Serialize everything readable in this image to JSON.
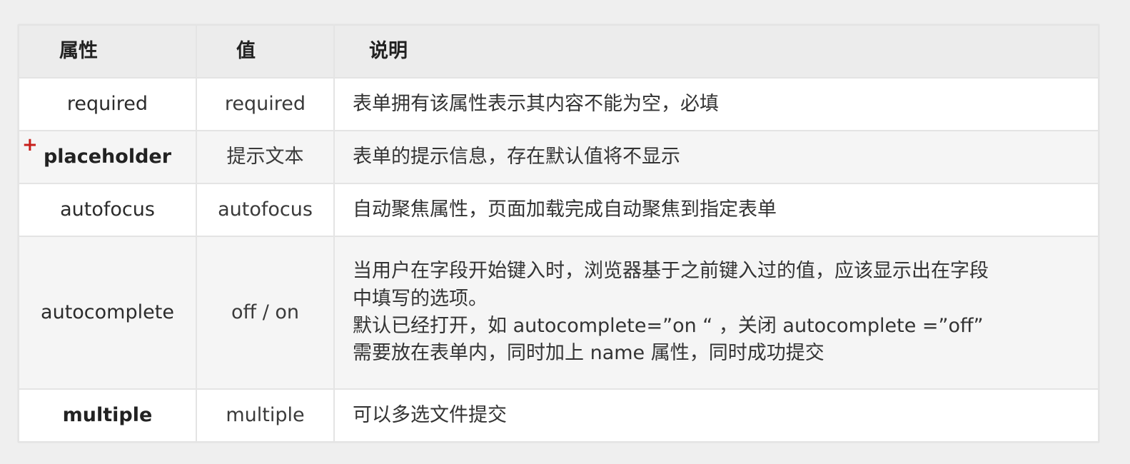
{
  "table": {
    "headers": [
      "属性",
      "值",
      "说明"
    ],
    "rows": [
      {
        "attribute": "required",
        "value": "required",
        "description": [
          "表单拥有该属性表示其内容不能为空，必填"
        ]
      },
      {
        "attribute": "placeholder",
        "value": "提示文本",
        "description": [
          "表单的提示信息，存在默认值将不显示"
        ],
        "marker": "+"
      },
      {
        "attribute": "autofocus",
        "value": "autofocus",
        "description": [
          "自动聚焦属性，页面加载完成自动聚焦到指定表单"
        ]
      },
      {
        "attribute": "autocomplete",
        "value": "off / on",
        "description": [
          "当用户在字段开始键入时，浏览器基于之前键入过的值，应该显示出在字段",
          "中填写的选项。",
          "默认已经打开，如 autocomplete=”on “ ，关闭 autocomplete =”off”",
          "需要放在表单内，同时加上 name 属性，同时成功提交"
        ]
      },
      {
        "attribute": "multiple",
        "value": "multiple",
        "description": [
          "可以多选文件提交"
        ]
      }
    ]
  },
  "colors": {
    "header_bg": "#ececec",
    "row_alt_bg": "#f5f5f5",
    "border": "#e4e4e4",
    "marker": "#c8201c"
  }
}
